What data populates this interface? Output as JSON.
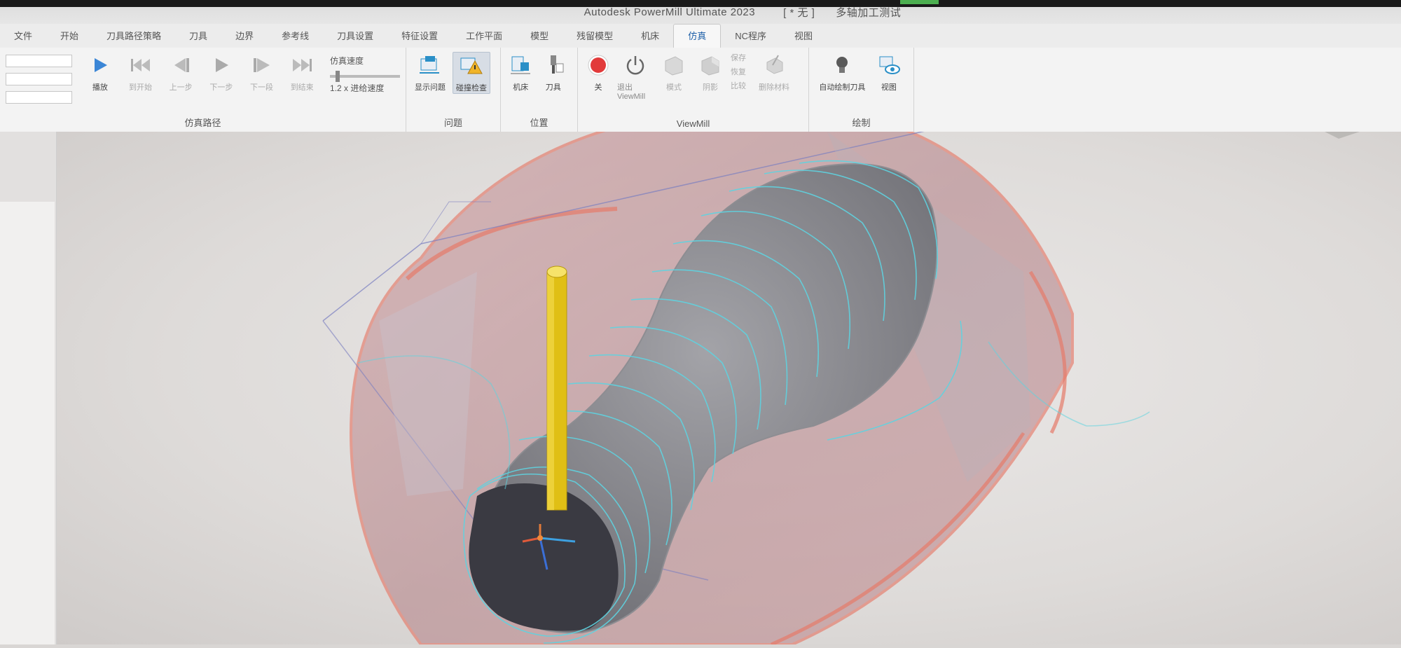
{
  "window": {
    "title": "Autodesk PowerMill Ultimate 2023",
    "doc_state": "[ * 无 ]",
    "project": "多轴加工测试"
  },
  "tabs": [
    {
      "label": "文件"
    },
    {
      "label": "开始"
    },
    {
      "label": "刀具路径策略"
    },
    {
      "label": "刀具"
    },
    {
      "label": "边界"
    },
    {
      "label": "参考线"
    },
    {
      "label": "刀具设置"
    },
    {
      "label": "特征设置"
    },
    {
      "label": "工作平面"
    },
    {
      "label": "模型"
    },
    {
      "label": "残留模型"
    },
    {
      "label": "机床"
    },
    {
      "label": "仿真",
      "active": true
    },
    {
      "label": "NC程序"
    },
    {
      "label": "视图"
    }
  ],
  "ribbon": {
    "groups": {
      "path": "仿真路径",
      "issues": "问题",
      "position": "位置",
      "viewmill": "ViewMill",
      "draw": "绘制"
    },
    "path_buttons": {
      "play": "播放",
      "rewind": "到开始",
      "step_back": "上一步",
      "step": "下一步",
      "step_forward": "下一段",
      "to_end": "到结束",
      "speed_label": "仿真速度",
      "speed_value": "1.2 x 进给速度"
    },
    "issue_buttons": {
      "show_issues": "显示问题",
      "collision": "碰撞检查"
    },
    "position_buttons": {
      "machine": "机床",
      "tool": "刀具"
    },
    "viewmill_buttons": {
      "off": "关",
      "exit": "退出 ViewMill",
      "mode": "模式",
      "shade": "阴影",
      "save": "保存",
      "restore": "恢复",
      "compare": "比较",
      "remove_material": "删除材料"
    },
    "draw_buttons": {
      "auto_draw_tool": "自动绘制刀具",
      "view": "视图"
    }
  },
  "colors": {
    "ribbon_bg": "#f3f3f3",
    "stock_fill": "#c98f93",
    "toolpath": "#5fd3e0",
    "tool": "#e8c81e",
    "record": "#e23a3a"
  }
}
